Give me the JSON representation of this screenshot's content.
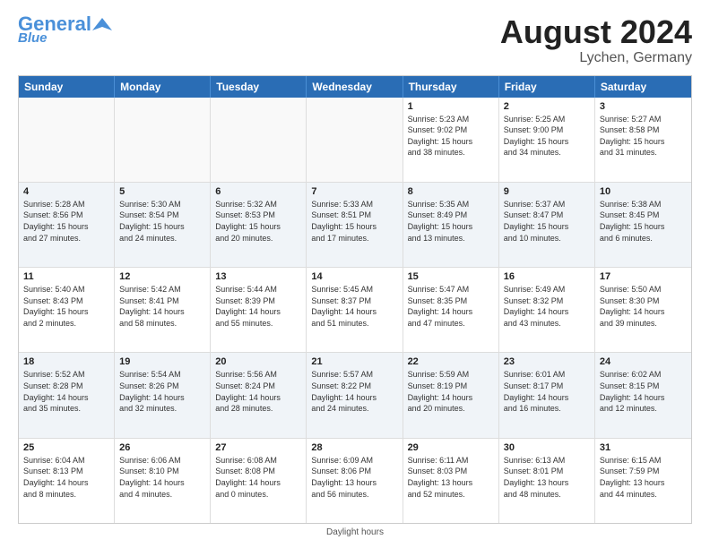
{
  "header": {
    "logo_general": "General",
    "logo_blue": "Blue",
    "month_year": "August 2024",
    "location": "Lychen, Germany"
  },
  "footer": {
    "note": "Daylight hours"
  },
  "days_of_week": [
    "Sunday",
    "Monday",
    "Tuesday",
    "Wednesday",
    "Thursday",
    "Friday",
    "Saturday"
  ],
  "weeks": [
    [
      {
        "day": "",
        "detail": ""
      },
      {
        "day": "",
        "detail": ""
      },
      {
        "day": "",
        "detail": ""
      },
      {
        "day": "",
        "detail": ""
      },
      {
        "day": "1",
        "detail": "Sunrise: 5:23 AM\nSunset: 9:02 PM\nDaylight: 15 hours\nand 38 minutes."
      },
      {
        "day": "2",
        "detail": "Sunrise: 5:25 AM\nSunset: 9:00 PM\nDaylight: 15 hours\nand 34 minutes."
      },
      {
        "day": "3",
        "detail": "Sunrise: 5:27 AM\nSunset: 8:58 PM\nDaylight: 15 hours\nand 31 minutes."
      }
    ],
    [
      {
        "day": "4",
        "detail": "Sunrise: 5:28 AM\nSunset: 8:56 PM\nDaylight: 15 hours\nand 27 minutes."
      },
      {
        "day": "5",
        "detail": "Sunrise: 5:30 AM\nSunset: 8:54 PM\nDaylight: 15 hours\nand 24 minutes."
      },
      {
        "day": "6",
        "detail": "Sunrise: 5:32 AM\nSunset: 8:53 PM\nDaylight: 15 hours\nand 20 minutes."
      },
      {
        "day": "7",
        "detail": "Sunrise: 5:33 AM\nSunset: 8:51 PM\nDaylight: 15 hours\nand 17 minutes."
      },
      {
        "day": "8",
        "detail": "Sunrise: 5:35 AM\nSunset: 8:49 PM\nDaylight: 15 hours\nand 13 minutes."
      },
      {
        "day": "9",
        "detail": "Sunrise: 5:37 AM\nSunset: 8:47 PM\nDaylight: 15 hours\nand 10 minutes."
      },
      {
        "day": "10",
        "detail": "Sunrise: 5:38 AM\nSunset: 8:45 PM\nDaylight: 15 hours\nand 6 minutes."
      }
    ],
    [
      {
        "day": "11",
        "detail": "Sunrise: 5:40 AM\nSunset: 8:43 PM\nDaylight: 15 hours\nand 2 minutes."
      },
      {
        "day": "12",
        "detail": "Sunrise: 5:42 AM\nSunset: 8:41 PM\nDaylight: 14 hours\nand 58 minutes."
      },
      {
        "day": "13",
        "detail": "Sunrise: 5:44 AM\nSunset: 8:39 PM\nDaylight: 14 hours\nand 55 minutes."
      },
      {
        "day": "14",
        "detail": "Sunrise: 5:45 AM\nSunset: 8:37 PM\nDaylight: 14 hours\nand 51 minutes."
      },
      {
        "day": "15",
        "detail": "Sunrise: 5:47 AM\nSunset: 8:35 PM\nDaylight: 14 hours\nand 47 minutes."
      },
      {
        "day": "16",
        "detail": "Sunrise: 5:49 AM\nSunset: 8:32 PM\nDaylight: 14 hours\nand 43 minutes."
      },
      {
        "day": "17",
        "detail": "Sunrise: 5:50 AM\nSunset: 8:30 PM\nDaylight: 14 hours\nand 39 minutes."
      }
    ],
    [
      {
        "day": "18",
        "detail": "Sunrise: 5:52 AM\nSunset: 8:28 PM\nDaylight: 14 hours\nand 35 minutes."
      },
      {
        "day": "19",
        "detail": "Sunrise: 5:54 AM\nSunset: 8:26 PM\nDaylight: 14 hours\nand 32 minutes."
      },
      {
        "day": "20",
        "detail": "Sunrise: 5:56 AM\nSunset: 8:24 PM\nDaylight: 14 hours\nand 28 minutes."
      },
      {
        "day": "21",
        "detail": "Sunrise: 5:57 AM\nSunset: 8:22 PM\nDaylight: 14 hours\nand 24 minutes."
      },
      {
        "day": "22",
        "detail": "Sunrise: 5:59 AM\nSunset: 8:19 PM\nDaylight: 14 hours\nand 20 minutes."
      },
      {
        "day": "23",
        "detail": "Sunrise: 6:01 AM\nSunset: 8:17 PM\nDaylight: 14 hours\nand 16 minutes."
      },
      {
        "day": "24",
        "detail": "Sunrise: 6:02 AM\nSunset: 8:15 PM\nDaylight: 14 hours\nand 12 minutes."
      }
    ],
    [
      {
        "day": "25",
        "detail": "Sunrise: 6:04 AM\nSunset: 8:13 PM\nDaylight: 14 hours\nand 8 minutes."
      },
      {
        "day": "26",
        "detail": "Sunrise: 6:06 AM\nSunset: 8:10 PM\nDaylight: 14 hours\nand 4 minutes."
      },
      {
        "day": "27",
        "detail": "Sunrise: 6:08 AM\nSunset: 8:08 PM\nDaylight: 14 hours\nand 0 minutes."
      },
      {
        "day": "28",
        "detail": "Sunrise: 6:09 AM\nSunset: 8:06 PM\nDaylight: 13 hours\nand 56 minutes."
      },
      {
        "day": "29",
        "detail": "Sunrise: 6:11 AM\nSunset: 8:03 PM\nDaylight: 13 hours\nand 52 minutes."
      },
      {
        "day": "30",
        "detail": "Sunrise: 6:13 AM\nSunset: 8:01 PM\nDaylight: 13 hours\nand 48 minutes."
      },
      {
        "day": "31",
        "detail": "Sunrise: 6:15 AM\nSunset: 7:59 PM\nDaylight: 13 hours\nand 44 minutes."
      }
    ]
  ]
}
